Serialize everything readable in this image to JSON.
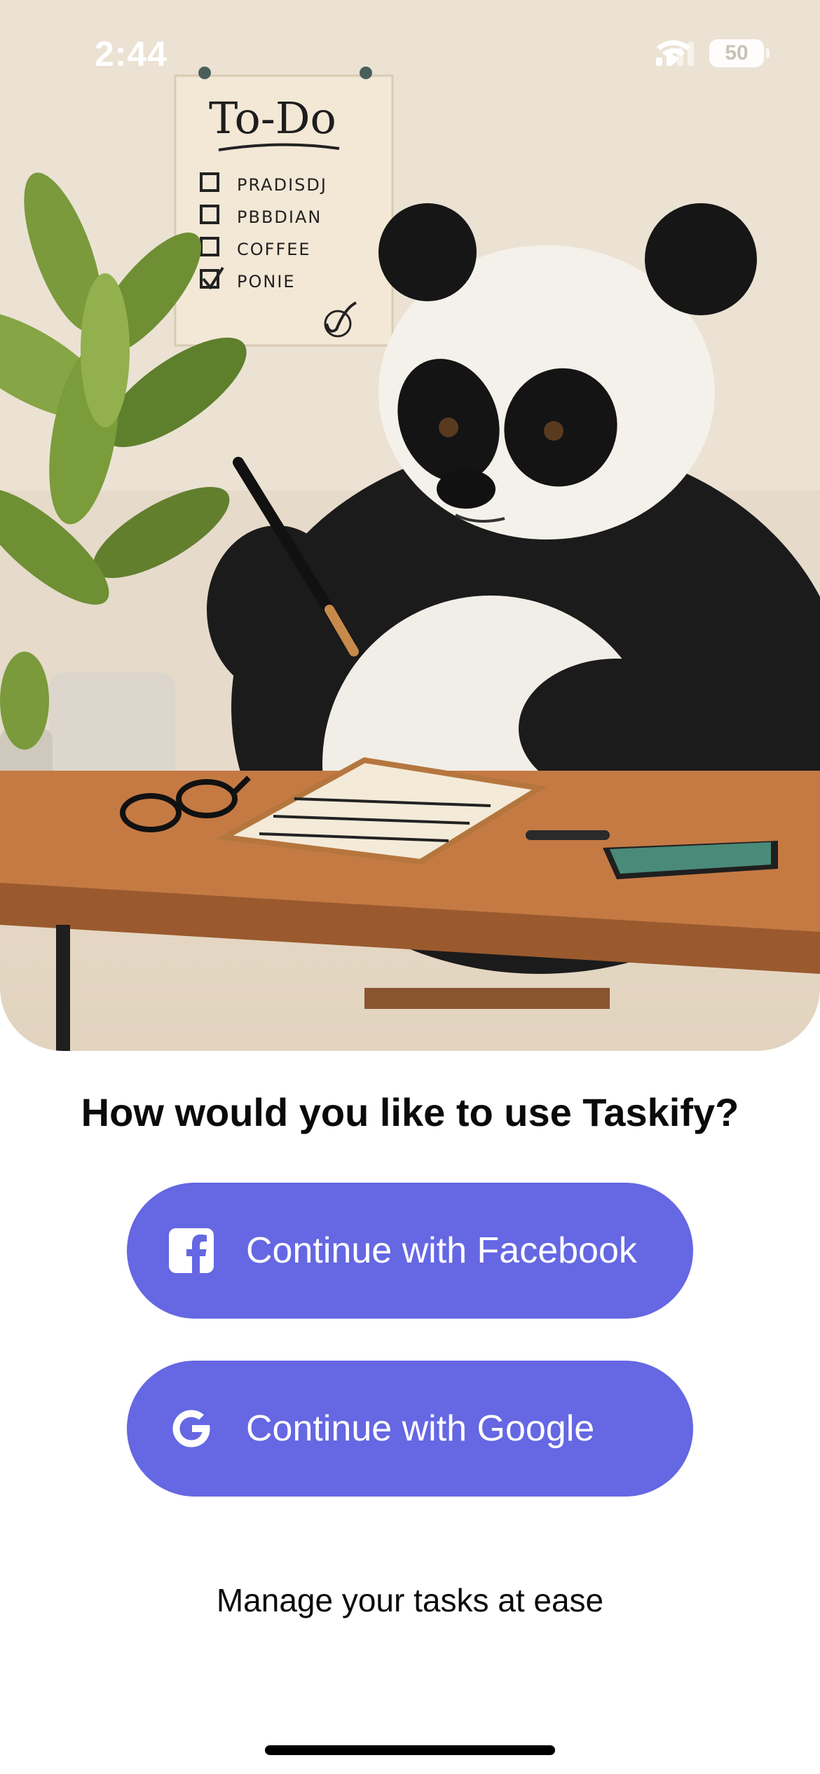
{
  "status_bar": {
    "time": "2:44",
    "battery_level": "50",
    "icons": [
      "signal-icon",
      "wifi-icon",
      "battery-icon"
    ]
  },
  "hero": {
    "illustration": "panda-at-desk-illustration",
    "note": {
      "title": "To-Do",
      "items": [
        "PRADISDJ",
        "PBBDIAN",
        "COFFEE",
        "PONIE"
      ]
    }
  },
  "headline": "How would you like to use Taskify?",
  "buttons": {
    "facebook": {
      "label": "Continue with Facebook",
      "icon": "facebook-icon"
    },
    "google": {
      "label": "Continue with Google",
      "icon": "google-icon"
    }
  },
  "tagline": "Manage your tasks at ease",
  "colors": {
    "button_background": "#6567e3",
    "button_text": "#ffffff",
    "text": "#0a0a0a",
    "background": "#ffffff"
  }
}
